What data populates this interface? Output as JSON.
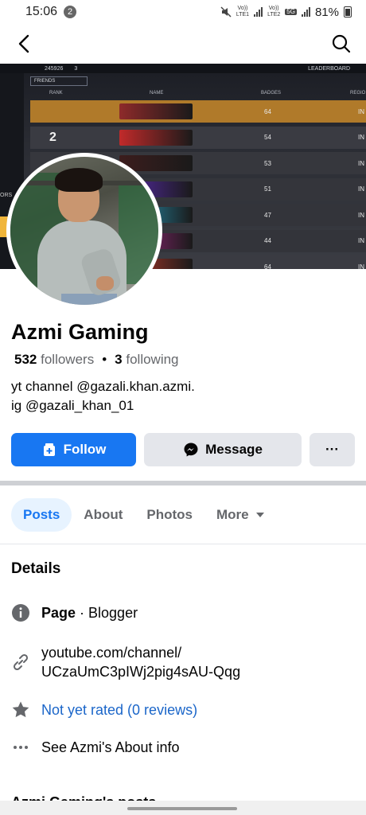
{
  "status_bar": {
    "time": "15:06",
    "notification_count": "2",
    "net1_top": "Vo))",
    "net1_bottom": "LTE1",
    "net2_top": "Vo))",
    "net2_bottom": "LTE2",
    "network_5g": "5G",
    "battery": "81%"
  },
  "nav": {
    "back_icon": "chevron-left-icon",
    "search_icon": "search-icon"
  },
  "cover": {
    "top_text": [
      "245926",
      "3",
      "LEADERBOARD"
    ],
    "dropdown_label": "FRIENDS",
    "headers": {
      "rank": "RANK",
      "name": "NAME",
      "badges": "BADGES",
      "region": "REGIO"
    },
    "rows": [
      {
        "rank": "",
        "badges": "64",
        "region": "IN",
        "bg": "#b07a2a",
        "name_color": "#8e2a2a"
      },
      {
        "rank": "2",
        "badges": "54",
        "region": "IN",
        "bg": "#3a3b42",
        "name_color": "#c12a2a"
      },
      {
        "rank": "",
        "badges": "53",
        "region": "IN",
        "bg": "#36373d",
        "name_color": "#3c1d1d"
      },
      {
        "rank": "",
        "badges": "51",
        "region": "IN",
        "bg": "#34353b",
        "name_color": "#5a2bb0"
      },
      {
        "rank": "",
        "badges": "47",
        "region": "IN",
        "bg": "#33343a",
        "name_color": "#2aa5c9"
      },
      {
        "rank": "",
        "badges": "44",
        "region": "IN",
        "bg": "#33343a",
        "name_color": "#b02a8e"
      },
      {
        "rank": "",
        "badges": "64",
        "region": "IN",
        "bg": "#3a3b42",
        "name_color": "#c23a2a"
      }
    ],
    "side_label": "ORS"
  },
  "profile": {
    "name": "Azmi Gaming",
    "followers_count": "532",
    "followers_label": "followers",
    "separator": "•",
    "following_count": "3",
    "following_label": "following",
    "bio_line1": "yt channel @gazali.khan.azmi.",
    "bio_line2": "ig @gazali_khan_01"
  },
  "actions": {
    "follow_label": "Follow",
    "message_label": "Message",
    "more_label": "···"
  },
  "tabs": [
    {
      "label": "Posts",
      "active": true
    },
    {
      "label": "About",
      "active": false
    },
    {
      "label": "Photos",
      "active": false
    },
    {
      "label": "More",
      "active": false
    }
  ],
  "details": {
    "title": "Details",
    "page_label": "Page",
    "page_category": " · Blogger",
    "link_line1": "youtube.com/channel/",
    "link_line2": "UCzaUmC3pIWj2pig4sAU-Qqg",
    "rating": "Not yet rated (0 reviews)",
    "about_link": "See Azmi's About info"
  },
  "cutoff_text": "Azmi Gaming's posts",
  "colors": {
    "accent": "#1877f2",
    "tab_active_bg": "#e7f3ff",
    "secondary_button": "#e4e6eb",
    "link": "#1b66c9"
  }
}
